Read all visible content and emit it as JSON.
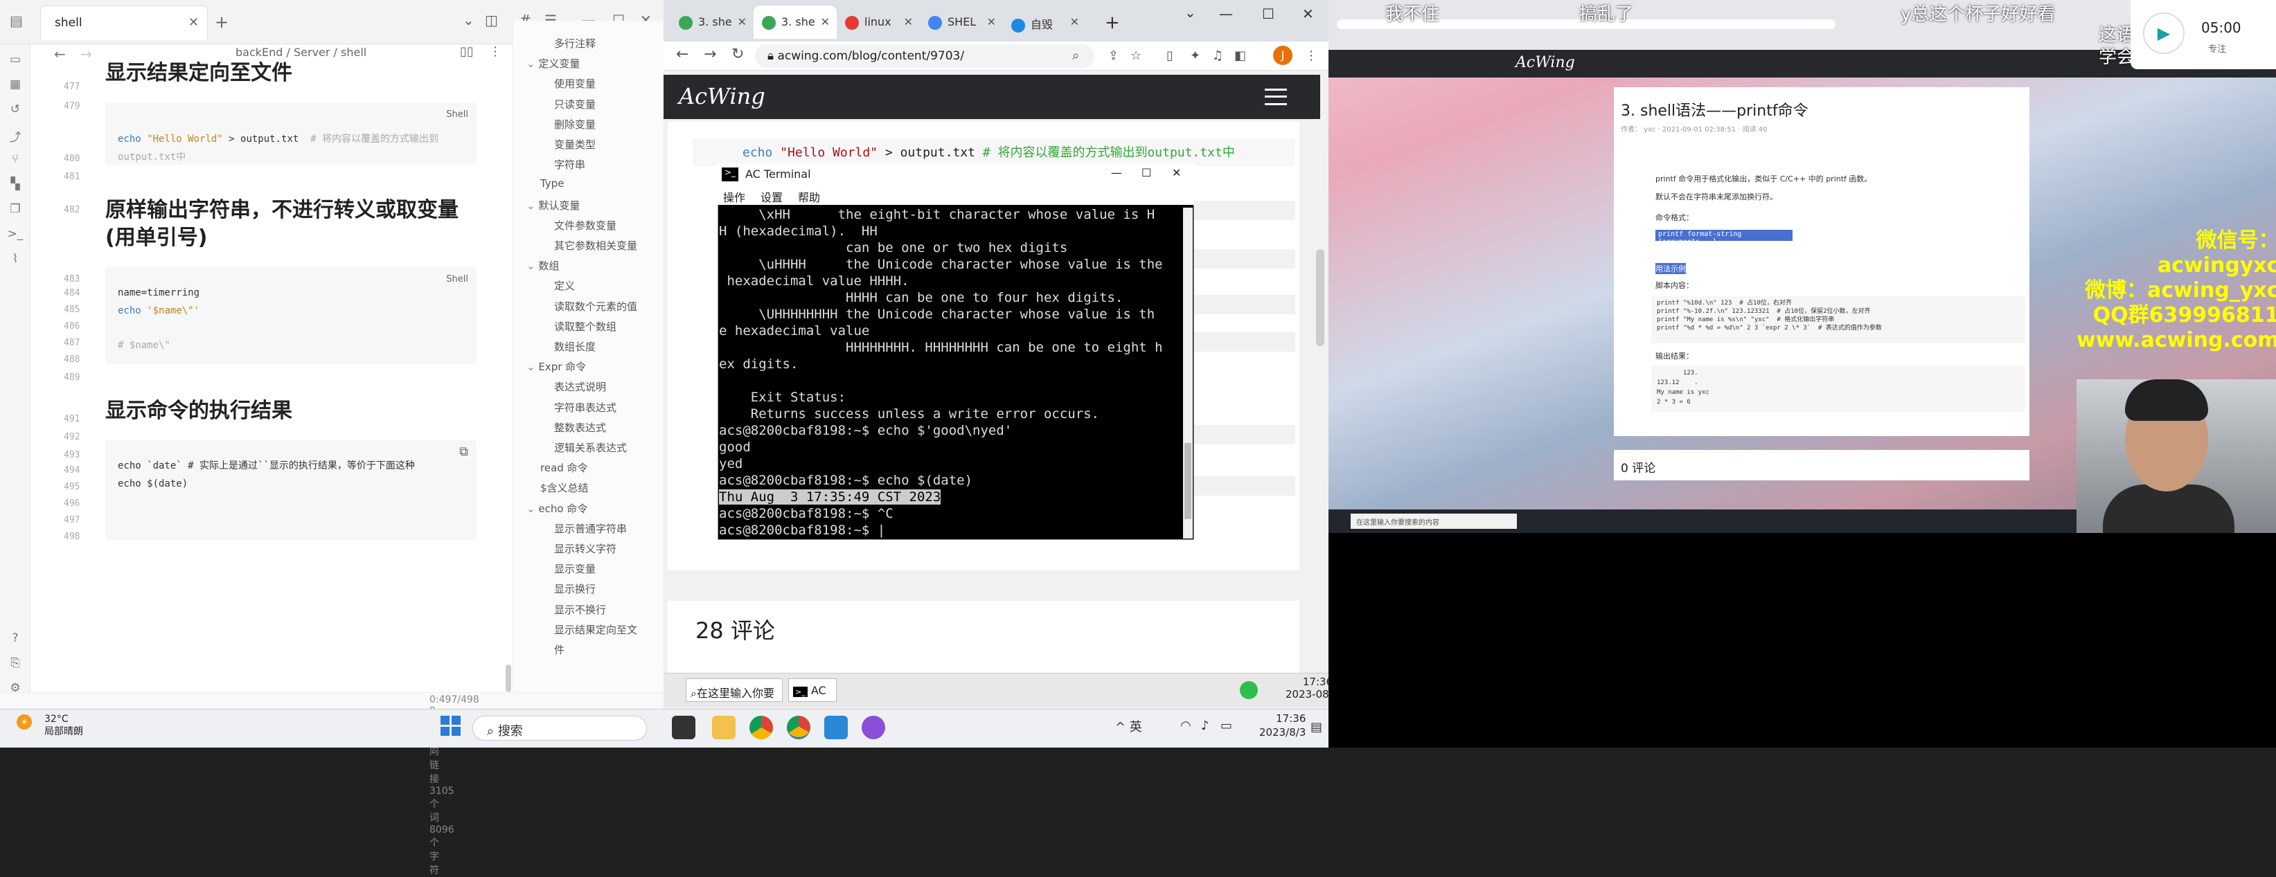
{
  "editor": {
    "tab_title": "shell",
    "breadcrumb": "backEnd  /  Server  /  shell",
    "lines": {
      "l477": "477",
      "l479": "479",
      "l480": "480",
      "l481": "481",
      "l482": "482",
      "l483": "483",
      "l484": "484",
      "l485": "485",
      "l486": "486",
      "l487": "487",
      "l488": "488",
      "l489": "489",
      "l491": "491",
      "l492": "492",
      "l493": "493",
      "l494": "494",
      "l495": "495",
      "l496": "496",
      "l497": "497",
      "l498": "498"
    },
    "heading_top": "显示结果定向至文件",
    "code1_a": "echo ",
    "code1_str": "\"Hello World\"",
    "code1_b": " > output.txt  ",
    "code1_cm": "# 将内容以覆盖的方式输出到",
    "code1_cm2": "output.txt中",
    "code1_lang": "Shell",
    "heading2": "原样输出字符串，不进行转义或取变量 (用单引号)",
    "code2_l1": "name=timerring",
    "code2_l2a": "echo ",
    "code2_l2b": "'$name\\\"'",
    "code2_l3": "# $name\\\"",
    "code2_lang": "Shell",
    "heading3": "显示命令的执行结果",
    "code3_l1": "echo `date` # 实际上是通过``显示的执行结果，等价于下面这种",
    "code3_l2": "echo $(date)",
    "status": "0:497/498   0 条反向链接   3105 个词  8096 个字符",
    "outline": [
      {
        "label": "多行注释",
        "lvl": 2
      },
      {
        "label": "定义变量",
        "lvl": 1
      },
      {
        "label": "使用变量",
        "lvl": 2
      },
      {
        "label": "只读变量",
        "lvl": 2
      },
      {
        "label": "删除变量",
        "lvl": 2
      },
      {
        "label": "变量类型",
        "lvl": 2
      },
      {
        "label": "字符串",
        "lvl": 2
      },
      {
        "label": "Type",
        "lvl": 0
      },
      {
        "label": "默认变量",
        "lvl": 1
      },
      {
        "label": "文件参数变量",
        "lvl": 2
      },
      {
        "label": "其它参数相关变量",
        "lvl": 2
      },
      {
        "label": "数组",
        "lvl": 1
      },
      {
        "label": "定义",
        "lvl": 2
      },
      {
        "label": "读取数个元素的值",
        "lvl": 2
      },
      {
        "label": "读取整个数组",
        "lvl": 2
      },
      {
        "label": "数组长度",
        "lvl": 2
      },
      {
        "label": "Expr 命令",
        "lvl": 1
      },
      {
        "label": "表达式说明",
        "lvl": 2
      },
      {
        "label": "字符串表达式",
        "lvl": 2
      },
      {
        "label": "整数表达式",
        "lvl": 2
      },
      {
        "label": "逻辑关系表达式",
        "lvl": 2
      },
      {
        "label": "read 命令",
        "lvl": 0
      },
      {
        "label": "$含义总结",
        "lvl": 0
      },
      {
        "label": "echo 命令",
        "lvl": 1
      },
      {
        "label": "显示普通字符串",
        "lvl": 2
      },
      {
        "label": "显示转义字符",
        "lvl": 2
      },
      {
        "label": "显示变量",
        "lvl": 2
      },
      {
        "label": "显示换行",
        "lvl": 2
      },
      {
        "label": "显示不换行",
        "lvl": 2
      },
      {
        "label": "显示结果定向至文",
        "lvl": 2
      },
      {
        "label": "件",
        "lvl": 2
      }
    ]
  },
  "chrome": {
    "tabs": [
      {
        "label": "3. she",
        "color": "#3aa757"
      },
      {
        "label": "3. she",
        "color": "#3aa757",
        "active": true
      },
      {
        "label": "linux",
        "color": "#e53935"
      },
      {
        "label": "SHEL",
        "color": "#4285f4"
      },
      {
        "label": "自毁",
        "color": "#1e88e5"
      }
    ],
    "url": "acwing.com/blog/content/9703/",
    "site_logo": "AcWing",
    "page_code_a": "echo ",
    "page_code_str": "\"Hello World\"",
    "page_code_b": " > output.txt  ",
    "page_code_cm": "# 将内容以覆盖的方式输出到output.txt中",
    "comments_title": "28 评论"
  },
  "terminal": {
    "title": "AC Terminal",
    "menu": [
      "操作",
      "设置",
      "帮助"
    ],
    "lines": [
      "     \\xHH      the eight-bit character whose value is H",
      "H (hexadecimal).  HH",
      "                can be one or two hex digits",
      "     \\uHHHH     the Unicode character whose value is the",
      " hexadecimal value HHHH.",
      "                HHHH can be one to four hex digits.",
      "     \\UHHHHHHHH the Unicode character whose value is th",
      "e hexadecimal value",
      "                HHHHHHHH. HHHHHHHH can be one to eight h",
      "ex digits.",
      "",
      "    Exit Status:",
      "    Returns success unless a write error occurs.",
      "acs@8200cbaf8198:~$ echo $'good\\nyed'",
      "good",
      "yed",
      "acs@8200cbaf8198:~$ echo $(date)"
    ],
    "highlight_line": "Thu Aug  3 17:35:49 CST 2023",
    "after_lines": [
      "acs@8200cbaf8198:~$ ^C",
      "acs@8200cbaf8198:~$ "
    ]
  },
  "mini_taskbar": {
    "search": "在这里输入你要",
    "app": "AC",
    "time": "17:36",
    "date": "2023-08-"
  },
  "video": {
    "danmaku": [
      "我不住",
      "搞乱了",
      "y总这个杯子好好看",
      "这语",
      "学会"
    ],
    "site_logo": "AcWing",
    "article_title": "3. shell语法——printf命令",
    "article_meta": "作者：  yxc  ·  2021-09-01 02:38:51  ·  阅读 40",
    "desc1": "printf 命令用于格式化输出，类似于 C/C++ 中的 printf 函数。",
    "desc2": "默认不会在字符串末尾添加换行符。",
    "format_label": "命令格式：",
    "format_code": "printf format-string [arguments...]",
    "usage_label": "用法示例",
    "script_label": "脚本内容：",
    "script_code": "printf \"%10d.\\n\" 123  # 占10位，右对齐\nprintf \"%-10.2f.\\n\" 123.123321  # 占10位，保留2位小数，左对齐\nprintf \"My name is %s\\n\" \"yxc\"  # 格式化输出字符串\nprintf \"%d * %d = %d\\n\" 2 3 `expr 2 \\* 3`  # 表达式的值作为参数",
    "output_label": "输出结果：",
    "output_code": "       123.\n123.12    .\nMy name is yxc\n2 * 3 = 6",
    "comments": "0 评论",
    "watermark": [
      "微信号：acwingyxc",
      "微博：acwing_yxc",
      "QQ群639996811",
      "www.acwing.com"
    ],
    "timer": "05:00",
    "focus": "专注",
    "mini_search": "在这里输入你要搜索的内容"
  },
  "taskbar": {
    "temp": "32°C",
    "weather": "局部晴朗",
    "search": "搜索",
    "tray": "^   英",
    "time": "17:36",
    "date": "2023/8/3"
  }
}
